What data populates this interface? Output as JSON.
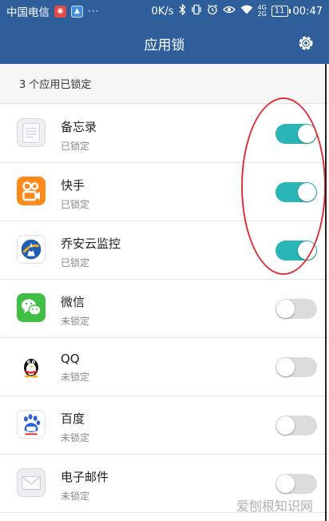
{
  "status_bar": {
    "carrier": "中国电信",
    "notif_1_icon": "camera-app-notification-icon",
    "notif_2_icon": "image-app-notification-icon",
    "more_dots": "···",
    "net_speed": "0K/s",
    "net_4g": "4G",
    "net_2g": "2G",
    "battery": "11",
    "time": "00:47"
  },
  "header": {
    "title": "应用锁",
    "settings_icon": "gear-icon"
  },
  "summary_text": "3 个应用已锁定",
  "apps": [
    {
      "name": "备忘录",
      "status": "已锁定",
      "locked": true
    },
    {
      "name": "快手",
      "status": "已锁定",
      "locked": true
    },
    {
      "name": "乔安云监控",
      "status": "已锁定",
      "locked": true
    },
    {
      "name": "微信",
      "status": "未锁定",
      "locked": false
    },
    {
      "name": "QQ",
      "status": "未锁定",
      "locked": false
    },
    {
      "name": "百度",
      "status": "未锁定",
      "locked": false
    },
    {
      "name": "电子邮件",
      "status": "未锁定",
      "locked": false
    }
  ],
  "watermark": "爱刨根知识网",
  "colors": {
    "header_bg": "#2f5f9b",
    "toggle_on": "#2ab6b6",
    "toggle_off": "#dcdcdc",
    "annotation_ring": "#e0303a"
  }
}
